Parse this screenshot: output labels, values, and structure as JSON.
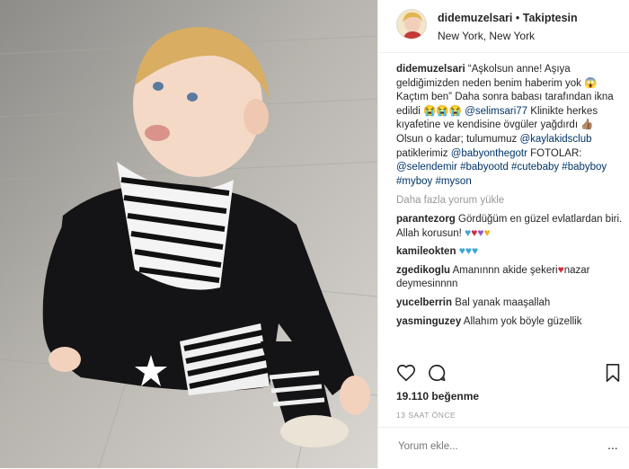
{
  "post": {
    "username": "didemuzelsari",
    "separator": "•",
    "follow_status": "Takiptesin",
    "location": "New York, New York"
  },
  "caption": {
    "user": "didemuzelsari",
    "text1": "“Aşkolsun anne! Aşıya geldiğimizden neden benim haberim yok",
    "text2": "Kaçtım ben” Daha sonra babası tarafından ikna edildi",
    "mention1": "@selimsari77",
    "text3": "Klinikte herkes kıyafetine ve kendisine övgüler yağdırdı",
    "text4": "Olsun o kadar; tulumumuz",
    "mention2": "@kaylakidsclub",
    "text5": "patiklerimiz",
    "mention3": "@babyonthegotr",
    "text6": "FOTOLAR:",
    "mention4": "@selendemir",
    "hashtags": "#babyootd #cutebaby #babyboy #myboy #myson"
  },
  "load_more": "Daha fazla yorum yükle",
  "comments": [
    {
      "user": "parantezorg",
      "text": "Gördüğüm en güzel evlatlardan biri. Allah korusun!"
    },
    {
      "user": "kamileokten",
      "text": ""
    },
    {
      "user": "zgedikoglu",
      "text": "Amanınnn akide şekeri",
      "text2": "nazar deymesinnnn"
    },
    {
      "user": "yucelberrin",
      "text": "Bal yanak maaşallah"
    },
    {
      "user": "yasminguzey",
      "text": "Allahım yok böyle güzellik"
    }
  ],
  "likes": "19.110 beğenme",
  "time": "13 SAAT ÖNCE",
  "comment_placeholder": "Yorum ekle...",
  "more_label": "...",
  "icons": [
    "heart-icon",
    "comment-icon",
    "bookmark-icon"
  ],
  "colors": {
    "link": "#003569",
    "muted": "#999999",
    "text": "#262626"
  }
}
